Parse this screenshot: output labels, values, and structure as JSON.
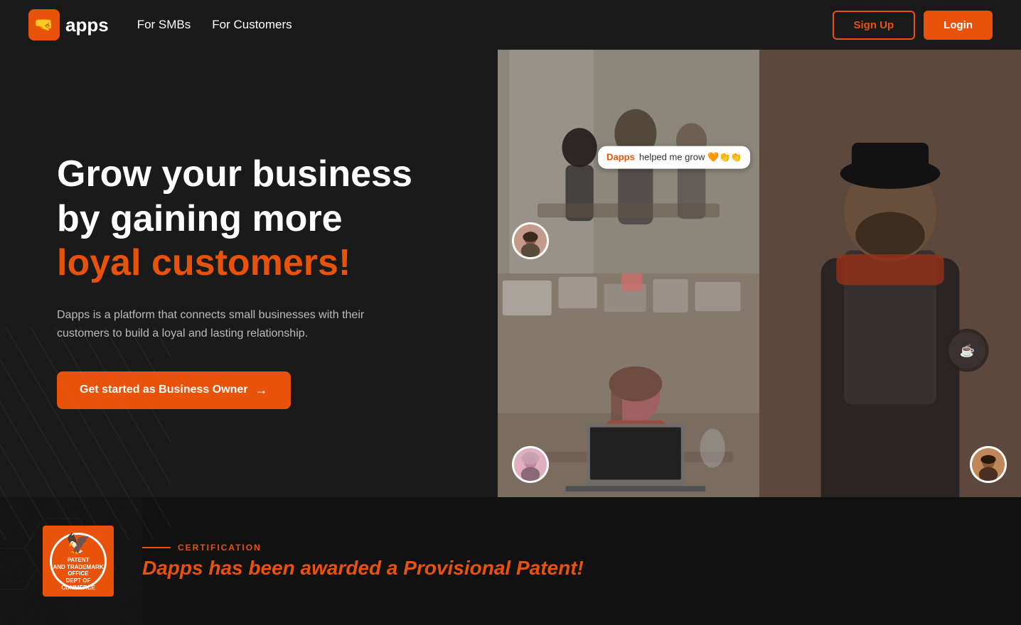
{
  "nav": {
    "logo_icon": "🤜",
    "logo_text": "apps",
    "links": [
      {
        "label": "For SMBs",
        "id": "for-smbs"
      },
      {
        "label": "For Customers",
        "id": "for-customers"
      }
    ],
    "signup_label": "Sign Up",
    "login_label": "Login"
  },
  "hero": {
    "title_line1": "Grow your business",
    "title_line2": "by gaining more",
    "title_accent": "loyal customers!",
    "description": "Dapps is a platform that connects small businesses with their customers to build a loyal and lasting relationship.",
    "cta_label": "Get started as Business Owner",
    "cta_arrow": "→",
    "chat_bubble": {
      "prefix": "Dapps",
      "suffix": " helped me grow 🧡👏👏"
    }
  },
  "certification": {
    "section_label": "CERTIFICATION",
    "text_prefix": "Dapps has been awarded a ",
    "text_accent": "Provisional Patent!",
    "badge_lines": [
      "PATENT",
      "AND TRADEMARK",
      "OFFICE",
      "DEPT OF COMMERCE"
    ]
  }
}
